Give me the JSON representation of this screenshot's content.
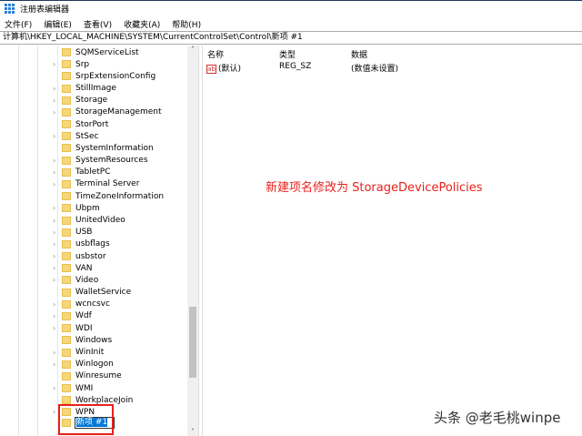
{
  "window": {
    "title": "注册表编辑器"
  },
  "menu": [
    "文件(F)",
    "编辑(E)",
    "查看(V)",
    "收藏夹(A)",
    "帮助(H)"
  ],
  "address": "计算机\\HKEY_LOCAL_MACHINE\\SYSTEM\\CurrentControlSet\\Control\\新项 #1",
  "tree": [
    {
      "label": "SQMServiceList",
      "exp": false
    },
    {
      "label": "Srp",
      "exp": true
    },
    {
      "label": "SrpExtensionConfig",
      "exp": false
    },
    {
      "label": "StillImage",
      "exp": true
    },
    {
      "label": "Storage",
      "exp": true
    },
    {
      "label": "StorageManagement",
      "exp": true
    },
    {
      "label": "StorPort",
      "exp": false
    },
    {
      "label": "StSec",
      "exp": true
    },
    {
      "label": "SystemInformation",
      "exp": false
    },
    {
      "label": "SystemResources",
      "exp": true
    },
    {
      "label": "TabletPC",
      "exp": true
    },
    {
      "label": "Terminal Server",
      "exp": true
    },
    {
      "label": "TimeZoneInformation",
      "exp": false
    },
    {
      "label": "Ubpm",
      "exp": true
    },
    {
      "label": "UnitedVideo",
      "exp": true
    },
    {
      "label": "USB",
      "exp": true
    },
    {
      "label": "usbflags",
      "exp": true
    },
    {
      "label": "usbstor",
      "exp": true
    },
    {
      "label": "VAN",
      "exp": true
    },
    {
      "label": "Video",
      "exp": true
    },
    {
      "label": "WalletService",
      "exp": false
    },
    {
      "label": "wcncsvc",
      "exp": true
    },
    {
      "label": "Wdf",
      "exp": true
    },
    {
      "label": "WDI",
      "exp": true
    },
    {
      "label": "Windows",
      "exp": false
    },
    {
      "label": "WinInit",
      "exp": true
    },
    {
      "label": "Winlogon",
      "exp": true
    },
    {
      "label": "Winresume",
      "exp": false
    },
    {
      "label": "WMI",
      "exp": true
    },
    {
      "label": "WorkplaceJoin",
      "exp": false
    },
    {
      "label": "WPN",
      "exp": true
    }
  ],
  "editing_item": "新项 #1",
  "columns": {
    "name": "名称",
    "type": "类型",
    "data": "数据"
  },
  "values": [
    {
      "name": "(默认)",
      "type": "REG_SZ",
      "data": "(数值未设置)"
    }
  ],
  "annotation": "新建项名修改为  StorageDevicePolicies",
  "watermark": "头条 @老毛桃winpe",
  "colors": {
    "annotation": "#e8201c",
    "selection": "#0078d7"
  }
}
